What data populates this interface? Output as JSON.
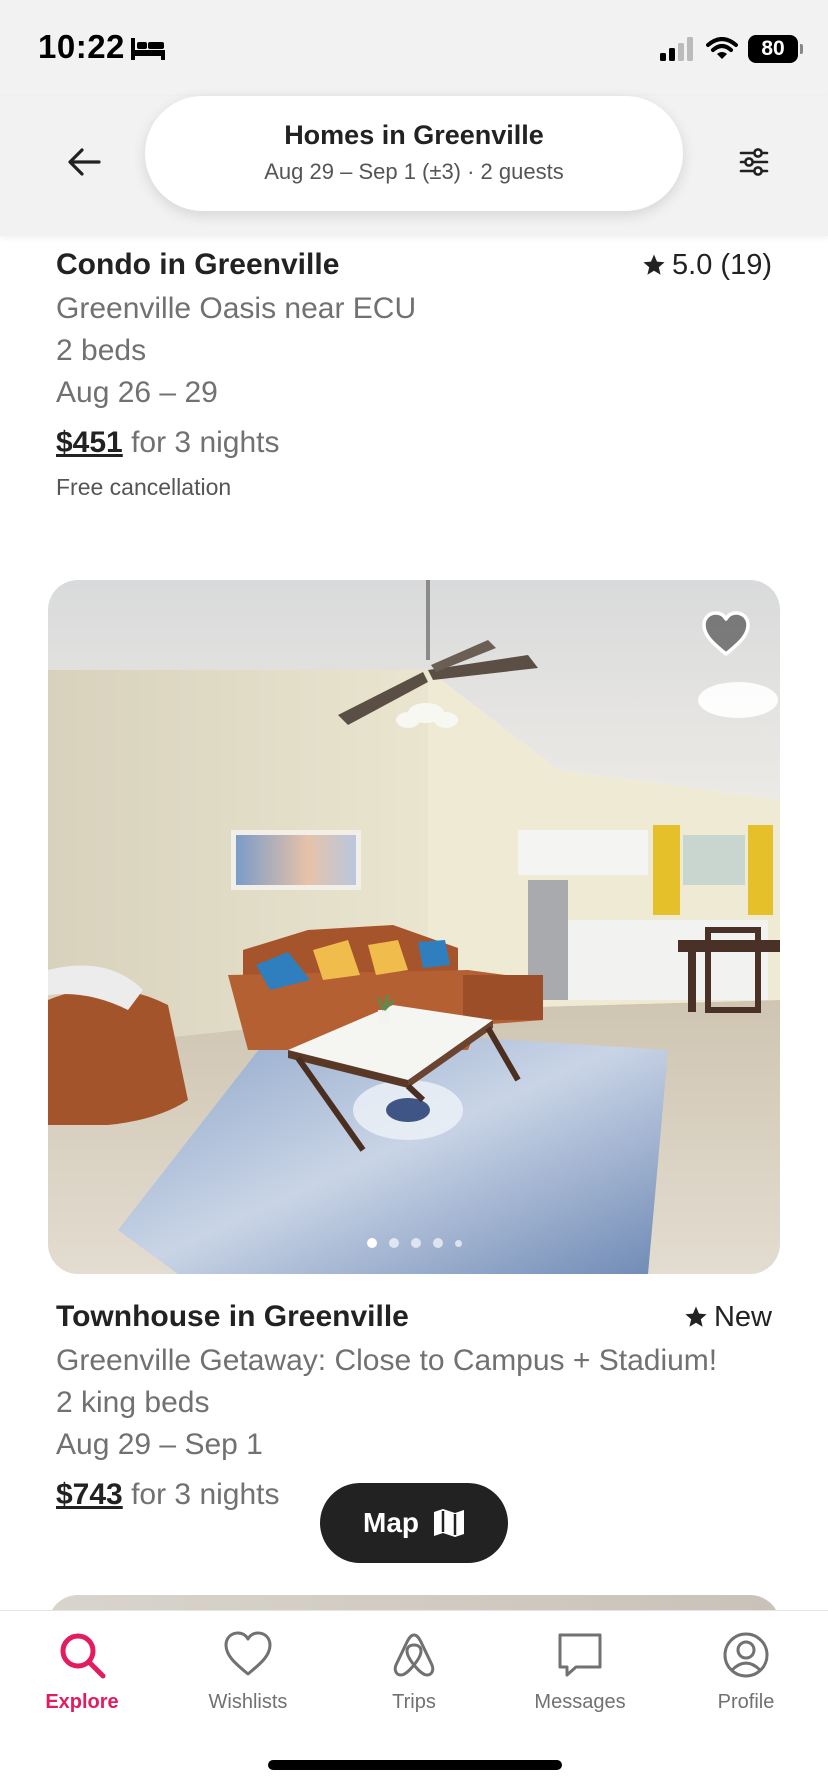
{
  "status_bar": {
    "time": "10:22",
    "battery": "80"
  },
  "header": {
    "title": "Homes in Greenville",
    "subtitle": "Aug 29 – Sep 1 (±3) · 2 guests"
  },
  "listings": [
    {
      "type": "Condo in Greenville",
      "rating": "5.0 (19)",
      "name": "Greenville Oasis near ECU",
      "beds": "2 beds",
      "dates": "Aug 26 – 29",
      "price": "$451",
      "price_suffix": " for 3 nights",
      "note": "Free cancellation"
    },
    {
      "type": "Townhouse in Greenville",
      "rating": "New",
      "name": "Greenville Getaway: Close to Campus + Stadium!",
      "beds": "2 king beds",
      "dates": "Aug 29 – Sep 1",
      "price": "$743",
      "price_suffix": " for 3 nights",
      "photo_count": 5,
      "photo_active": 1
    }
  ],
  "map_button": {
    "label": "Map"
  },
  "tabs": [
    {
      "label": "Explore",
      "icon": "search-icon",
      "active": true
    },
    {
      "label": "Wishlists",
      "icon": "heart-icon",
      "active": false
    },
    {
      "label": "Trips",
      "icon": "airbnb-logo-icon",
      "active": false
    },
    {
      "label": "Messages",
      "icon": "message-icon",
      "active": false
    },
    {
      "label": "Profile",
      "icon": "profile-icon",
      "active": false
    }
  ],
  "colors": {
    "accent": "#e31c5f",
    "text": "#222222",
    "secondary": "#717171"
  }
}
